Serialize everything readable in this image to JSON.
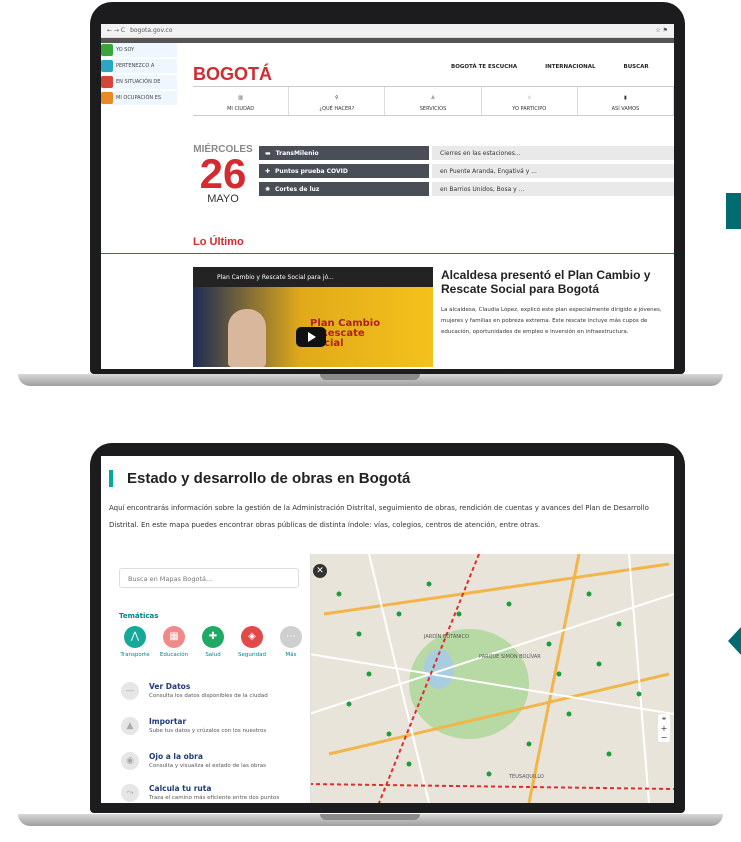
{
  "top": {
    "browser": {
      "nav": "← → C",
      "url": "bogota.gov.co",
      "actions": "☆  ⚑"
    },
    "sidenav": [
      {
        "label": "YO SOY",
        "color": "#3aa53a"
      },
      {
        "label": "PERTENEZCO A",
        "color": "#2aa7c4"
      },
      {
        "label": "EN SITUACIÓN DE",
        "color": "#d4453a"
      },
      {
        "label": "MI OCUPACIÓN ES",
        "color": "#e98a25"
      }
    ],
    "logo": "BOGOTÁ",
    "topnav": [
      "BOGOTÁ TE ESCUCHA",
      "INTERNACIONAL",
      "BUSCAR"
    ],
    "menu": [
      {
        "label": "MI CIUDAD",
        "icon": "city-icon"
      },
      {
        "label": "¿QUÉ HACER?",
        "icon": "bike-icon"
      },
      {
        "label": "SERVICIOS",
        "icon": "person-icon"
      },
      {
        "label": "YO PARTICIPO",
        "icon": "hand-icon"
      },
      {
        "label": "ASÍ VAMOS",
        "icon": "chart-icon"
      }
    ],
    "date": {
      "weekday": "MIÉRCOLES",
      "day": "26",
      "month": "MAYO"
    },
    "alerts": [
      {
        "label": "TransMilenio",
        "text": "Cierres en las estaciones..."
      },
      {
        "label": "Puntos prueba COVID",
        "text": "en Puente Aranda, Engativá y ..."
      },
      {
        "label": "Cortes de luz",
        "text": "en Barrios Unidos, Bosa y ..."
      }
    ],
    "section": "Lo Último",
    "video": {
      "title": "Plan Cambio y Rescate Social para jó...",
      "overlay": "Plan Cambio y Rescate Social"
    },
    "news": {
      "title": "Alcaldesa presentó el Plan Cambio y Rescate Social para Bogotá",
      "body": "La alcaldesa, Claudia López, explicó este plan especialmente dirigido a jóvenes, mujeres y familias en pobreza extrema. Este rescate incluye más cupos de educación, oportunidades de empleo e inversión en infraestructura."
    }
  },
  "bottom": {
    "title": "Estado y desarrollo de obras en Bogotá",
    "desc": "Aquí encontrarás información sobre la gestión de la Administración Distrital, seguimiento de obras, rendición de cuentas y avances del Plan de Desarrollo Distrital. En este mapa puedes encontrar obras públicas de distinta índole: vías, colegios, centros de atención, entre otras.",
    "search_placeholder": "Busca en Mapas Bogotá...",
    "tematicas": "Temáticas",
    "cats": [
      {
        "label": "Transporte",
        "color": "#17a89a"
      },
      {
        "label": "Educación",
        "color": "#f08a8a"
      },
      {
        "label": "Salud",
        "color": "#1faa63"
      },
      {
        "label": "Seguridad",
        "color": "#e24a4a"
      },
      {
        "label": "Más",
        "color": "#cfcfcf"
      }
    ],
    "options": [
      {
        "title": "Ver Datos",
        "sub": "Consulta los datos disponibles de la ciudad"
      },
      {
        "title": "Importar",
        "sub": "Sube tus datos y crúzalos con los nuestros"
      },
      {
        "title": "Ojo a la obra",
        "sub": "Consulta y visualiza el estado de las obras"
      },
      {
        "title": "Calcula tu ruta",
        "sub": "Traza el camino más eficiente entre dos puntos"
      }
    ],
    "map_labels": [
      "JARDÍN BOTÁNICO",
      "PARQUE SIMÓN BOLÍVAR",
      "TEUSAQUILLO"
    ]
  }
}
